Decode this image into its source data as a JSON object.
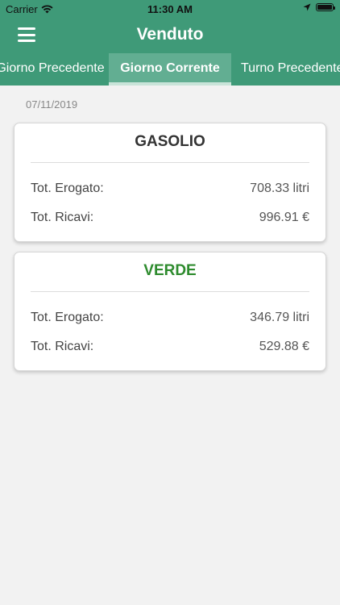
{
  "status_bar": {
    "carrier": "Carrier",
    "time": "11:30 AM"
  },
  "nav": {
    "title": "Venduto",
    "menu_icon": "hamburger-menu-icon"
  },
  "tabs": [
    {
      "label": "Giorno Precedente",
      "active": false
    },
    {
      "label": "Giorno Corrente",
      "active": true
    },
    {
      "label": "Turno Precedente",
      "active": false
    }
  ],
  "date": "07/11/2019",
  "cards": [
    {
      "fuel": "GASOLIO",
      "fuel_color": "#333333",
      "erogato_label": "Tot. Erogato:",
      "erogato_value": "708.33 litri",
      "ricavi_label": "Tot. Ricavi:",
      "ricavi_value": "996.91 €"
    },
    {
      "fuel": "VERDE",
      "fuel_color": "#2e8b2e",
      "erogato_label": "Tot. Erogato:",
      "erogato_value": "346.79 litri",
      "ricavi_label": "Tot. Ricavi:",
      "ricavi_value": "529.88 €"
    }
  ],
  "colors": {
    "primary": "#3f9a78",
    "tab_active": "#62ae92",
    "background": "#f2f2f2"
  }
}
